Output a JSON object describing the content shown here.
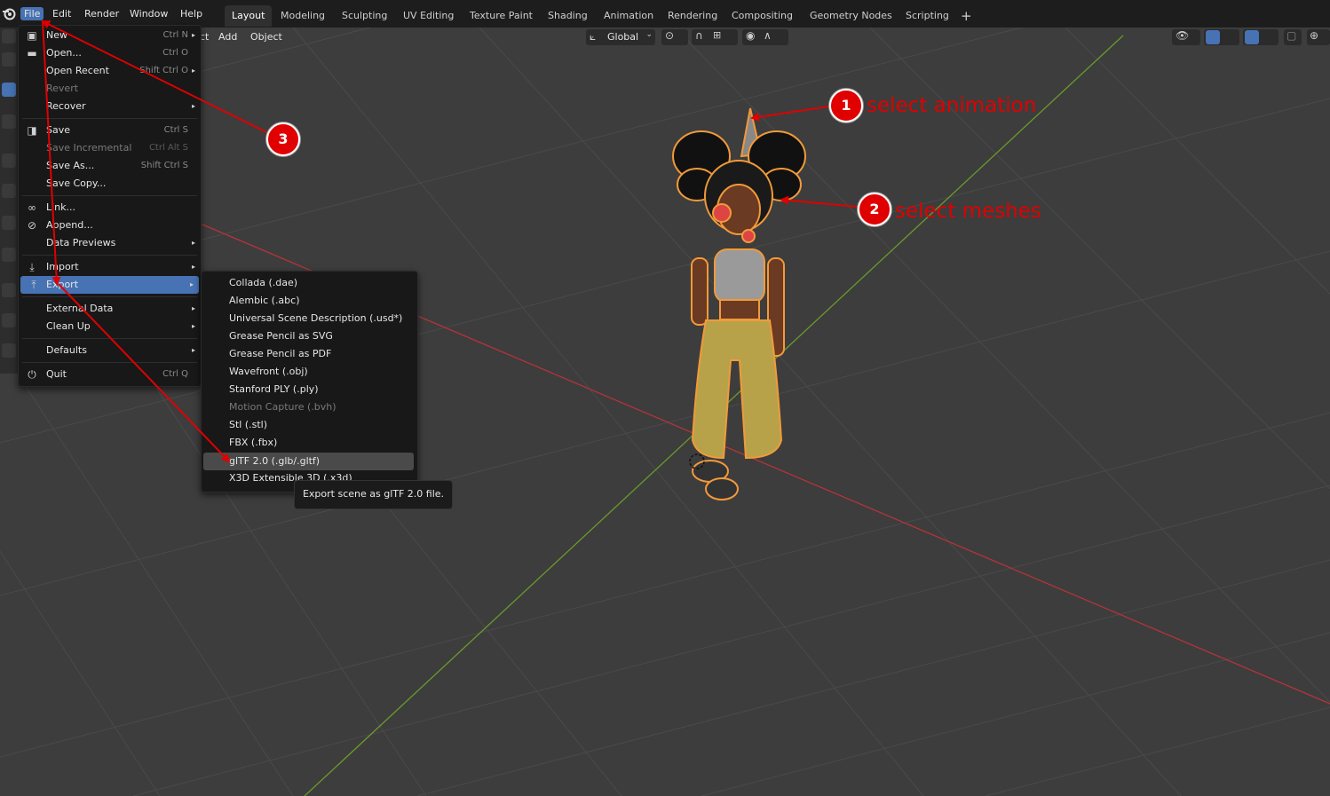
{
  "topbar": {
    "menus": [
      "File",
      "Edit",
      "Render",
      "Window",
      "Help"
    ],
    "workspaces": [
      "Layout",
      "Modeling",
      "Sculpting",
      "UV Editing",
      "Texture Paint",
      "Shading",
      "Animation",
      "Rendering",
      "Compositing",
      "Geometry Nodes",
      "Scripting"
    ],
    "add_tab": "+"
  },
  "viewport_header": {
    "partial_menu": "ct",
    "add": "Add",
    "object": "Object",
    "transform_orientation": "Global"
  },
  "file_menu": {
    "items": [
      {
        "label": "New",
        "shortcut": "Ctrl N",
        "icon": "new-file-icon",
        "arrow": true,
        "disabled": false
      },
      {
        "label": "Open...",
        "shortcut": "Ctrl O",
        "icon": "folder-icon",
        "arrow": false,
        "disabled": false
      },
      {
        "label": "Open Recent",
        "shortcut": "Shift Ctrl O",
        "icon": "",
        "arrow": true,
        "disabled": false
      },
      {
        "label": "Revert",
        "shortcut": "",
        "icon": "",
        "arrow": false,
        "disabled": true
      },
      {
        "label": "Recover",
        "shortcut": "",
        "icon": "",
        "arrow": true,
        "disabled": false
      },
      {
        "label": "Save",
        "shortcut": "Ctrl S",
        "icon": "save-icon",
        "arrow": false,
        "disabled": false
      },
      {
        "label": "Save Incremental",
        "shortcut": "Ctrl Alt S",
        "icon": "",
        "arrow": false,
        "disabled": true
      },
      {
        "label": "Save As...",
        "shortcut": "Shift Ctrl S",
        "icon": "",
        "arrow": false,
        "disabled": false
      },
      {
        "label": "Save Copy...",
        "shortcut": "",
        "icon": "",
        "arrow": false,
        "disabled": false
      },
      {
        "label": "Link...",
        "shortcut": "",
        "icon": "link-icon",
        "arrow": false,
        "disabled": false
      },
      {
        "label": "Append...",
        "shortcut": "",
        "icon": "append-icon",
        "arrow": false,
        "disabled": false
      },
      {
        "label": "Data Previews",
        "shortcut": "",
        "icon": "",
        "arrow": true,
        "disabled": false
      },
      {
        "label": "Import",
        "shortcut": "",
        "icon": "import-icon",
        "arrow": true,
        "disabled": false
      },
      {
        "label": "Export",
        "shortcut": "",
        "icon": "export-icon",
        "arrow": true,
        "disabled": false,
        "highlighted": true
      },
      {
        "label": "External Data",
        "shortcut": "",
        "icon": "",
        "arrow": true,
        "disabled": false
      },
      {
        "label": "Clean Up",
        "shortcut": "",
        "icon": "",
        "arrow": true,
        "disabled": false
      },
      {
        "label": "Defaults",
        "shortcut": "",
        "icon": "",
        "arrow": true,
        "disabled": false
      },
      {
        "label": "Quit",
        "shortcut": "Ctrl Q",
        "icon": "power-icon",
        "arrow": false,
        "disabled": false
      }
    ]
  },
  "export_menu": {
    "items": [
      {
        "label": "Collada (.dae)",
        "disabled": false
      },
      {
        "label": "Alembic (.abc)",
        "disabled": false
      },
      {
        "label": "Universal Scene Description (.usd*)",
        "disabled": false
      },
      {
        "label": "Grease Pencil as SVG",
        "disabled": false
      },
      {
        "label": "Grease Pencil as PDF",
        "disabled": false
      },
      {
        "label": "Wavefront (.obj)",
        "disabled": false
      },
      {
        "label": "Stanford PLY (.ply)",
        "disabled": false
      },
      {
        "label": "Motion Capture (.bvh)",
        "disabled": true
      },
      {
        "label": "Stl (.stl)",
        "disabled": false
      },
      {
        "label": "FBX (.fbx)",
        "disabled": false
      },
      {
        "label": "glTF 2.0 (.glb/.gltf)",
        "disabled": false,
        "highlighted": true
      },
      {
        "label": "X3D Extensible 3D (.x3d)",
        "disabled": false
      }
    ]
  },
  "tooltip": "Export scene as glTF 2.0 file.",
  "annotations": [
    {
      "number": "1",
      "text": "select animation"
    },
    {
      "number": "2",
      "text": "select meshes"
    },
    {
      "number": "3",
      "text": ""
    }
  ],
  "colors": {
    "accent": "#4772b3",
    "annotation_red": "#e00000",
    "x_axis": "#b5343a",
    "y_axis": "#6a9a2c",
    "outline_orange": "#f29a3a"
  }
}
